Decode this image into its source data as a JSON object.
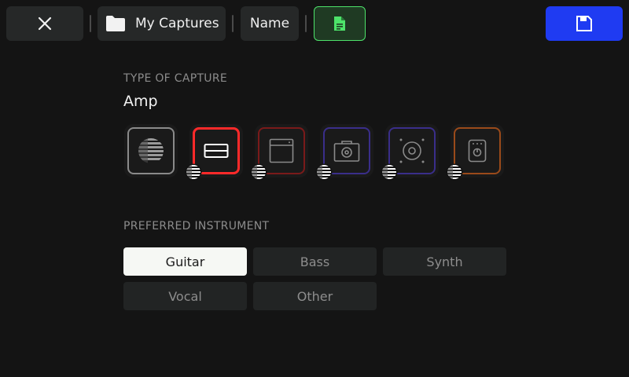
{
  "topbar": {
    "close_icon": "close-icon",
    "folder": {
      "icon": "folder-icon",
      "label": "My Captures"
    },
    "name_label": "Name",
    "doc_icon": "document-icon",
    "save_icon": "save-icon"
  },
  "capture_type": {
    "label": "TYPE OF CAPTURE",
    "value": "Amp",
    "options": [
      {
        "name": "full-rig",
        "icon": "striped-sphere-icon",
        "color": "#9a9a9a",
        "selected": false
      },
      {
        "name": "amp-head",
        "icon": "amp-head-icon",
        "color": "#ff2a2a",
        "selected": true
      },
      {
        "name": "combo-amp",
        "icon": "combo-amp-icon",
        "color": "#7a1a1a",
        "selected": false
      },
      {
        "name": "cabinet",
        "icon": "cabinet-icon",
        "color": "#3a2e8a",
        "selected": false
      },
      {
        "name": "speaker",
        "icon": "speaker-icon",
        "color": "#3a2e8a",
        "selected": false
      },
      {
        "name": "pedal",
        "icon": "pedal-icon",
        "color": "#9a4a1a",
        "selected": false
      }
    ]
  },
  "instrument": {
    "label": "PREFERRED INSTRUMENT",
    "options": [
      {
        "label": "Guitar",
        "selected": true
      },
      {
        "label": "Bass",
        "selected": false
      },
      {
        "label": "Synth",
        "selected": false
      },
      {
        "label": "Vocal",
        "selected": false
      },
      {
        "label": "Other",
        "selected": false
      }
    ]
  },
  "colors": {
    "accent_save": "#1f3bf2",
    "accent_doc": "#4de36a",
    "selected_amp": "#ff2a2a"
  }
}
